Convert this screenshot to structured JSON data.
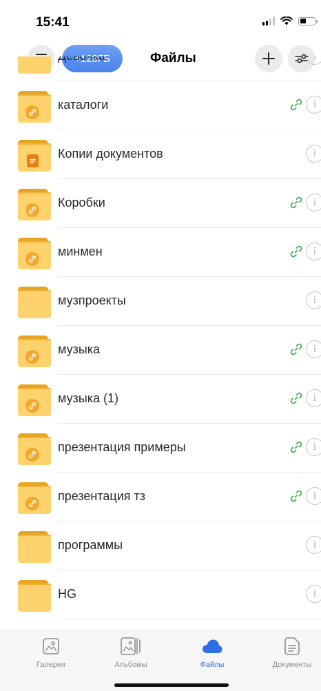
{
  "status_bar": {
    "time": "15:41",
    "battery_level": 0.4
  },
  "header": {
    "storage_label": "+128ГБ",
    "title": "Файлы"
  },
  "files": [
    {
      "name": "Девочка",
      "shared": false,
      "type": "folder"
    },
    {
      "name": "каталоги",
      "shared": true,
      "type": "folder"
    },
    {
      "name": "Копии документов",
      "shared": false,
      "type": "documents-folder"
    },
    {
      "name": "Коробки",
      "shared": true,
      "type": "folder"
    },
    {
      "name": "минмен",
      "shared": true,
      "type": "folder"
    },
    {
      "name": "музпроекты",
      "shared": false,
      "type": "folder"
    },
    {
      "name": "музыка",
      "shared": true,
      "type": "folder"
    },
    {
      "name": "музыка (1)",
      "shared": true,
      "type": "folder"
    },
    {
      "name": "презентация примеры",
      "shared": true,
      "type": "folder"
    },
    {
      "name": "презентация тз",
      "shared": true,
      "type": "folder"
    },
    {
      "name": "программы",
      "shared": false,
      "type": "folder"
    },
    {
      "name": "HG",
      "shared": false,
      "type": "folder"
    }
  ],
  "info_glyph": "i",
  "tab_bar": {
    "active": "files",
    "tabs": [
      {
        "id": "gallery",
        "label": "Галерея",
        "icon": "gallery-icon"
      },
      {
        "id": "albums",
        "label": "Альбомы",
        "icon": "albums-icon"
      },
      {
        "id": "files",
        "label": "Файлы",
        "icon": "cloud-icon"
      },
      {
        "id": "documents",
        "label": "Документы",
        "icon": "document-icon"
      }
    ]
  },
  "colors": {
    "accent": "#2f6ee4",
    "folder": "#fed36d",
    "folder_badge": "#f1a82c",
    "link": "#3db04a"
  }
}
